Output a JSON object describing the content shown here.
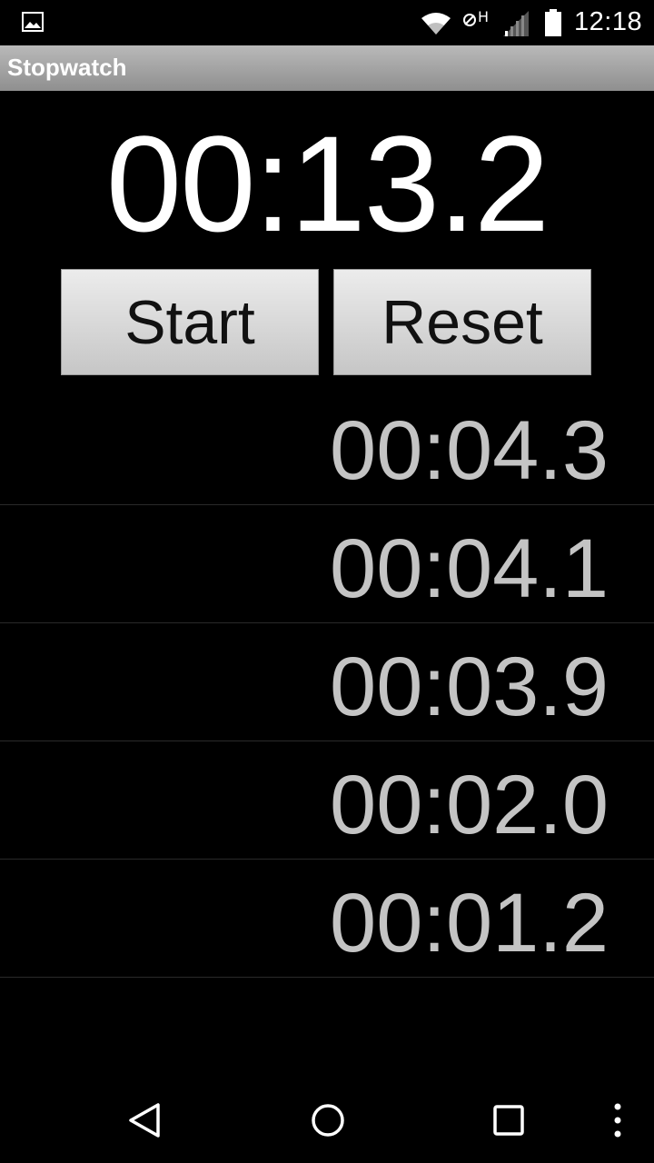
{
  "status_bar": {
    "time": "12:18",
    "icons": [
      "gallery-icon",
      "wifi-icon",
      "data-h-icon",
      "signal-icon",
      "battery-icon"
    ]
  },
  "action_bar": {
    "title": "Stopwatch"
  },
  "stopwatch": {
    "elapsed": "00:13.2",
    "start_label": "Start",
    "reset_label": "Reset"
  },
  "laps": [
    {
      "time": "00:04.3"
    },
    {
      "time": "00:04.1"
    },
    {
      "time": "00:03.9"
    },
    {
      "time": "00:02.0"
    },
    {
      "time": "00:01.2"
    }
  ],
  "nav_bar": {
    "icons": [
      "back-icon",
      "home-icon",
      "recents-icon",
      "overflow-menu-icon"
    ]
  },
  "colors": {
    "background": "#000000",
    "action_bar": "#a4a4a4",
    "lap_text": "#c4c4c4",
    "button": "#dcdcdc"
  }
}
